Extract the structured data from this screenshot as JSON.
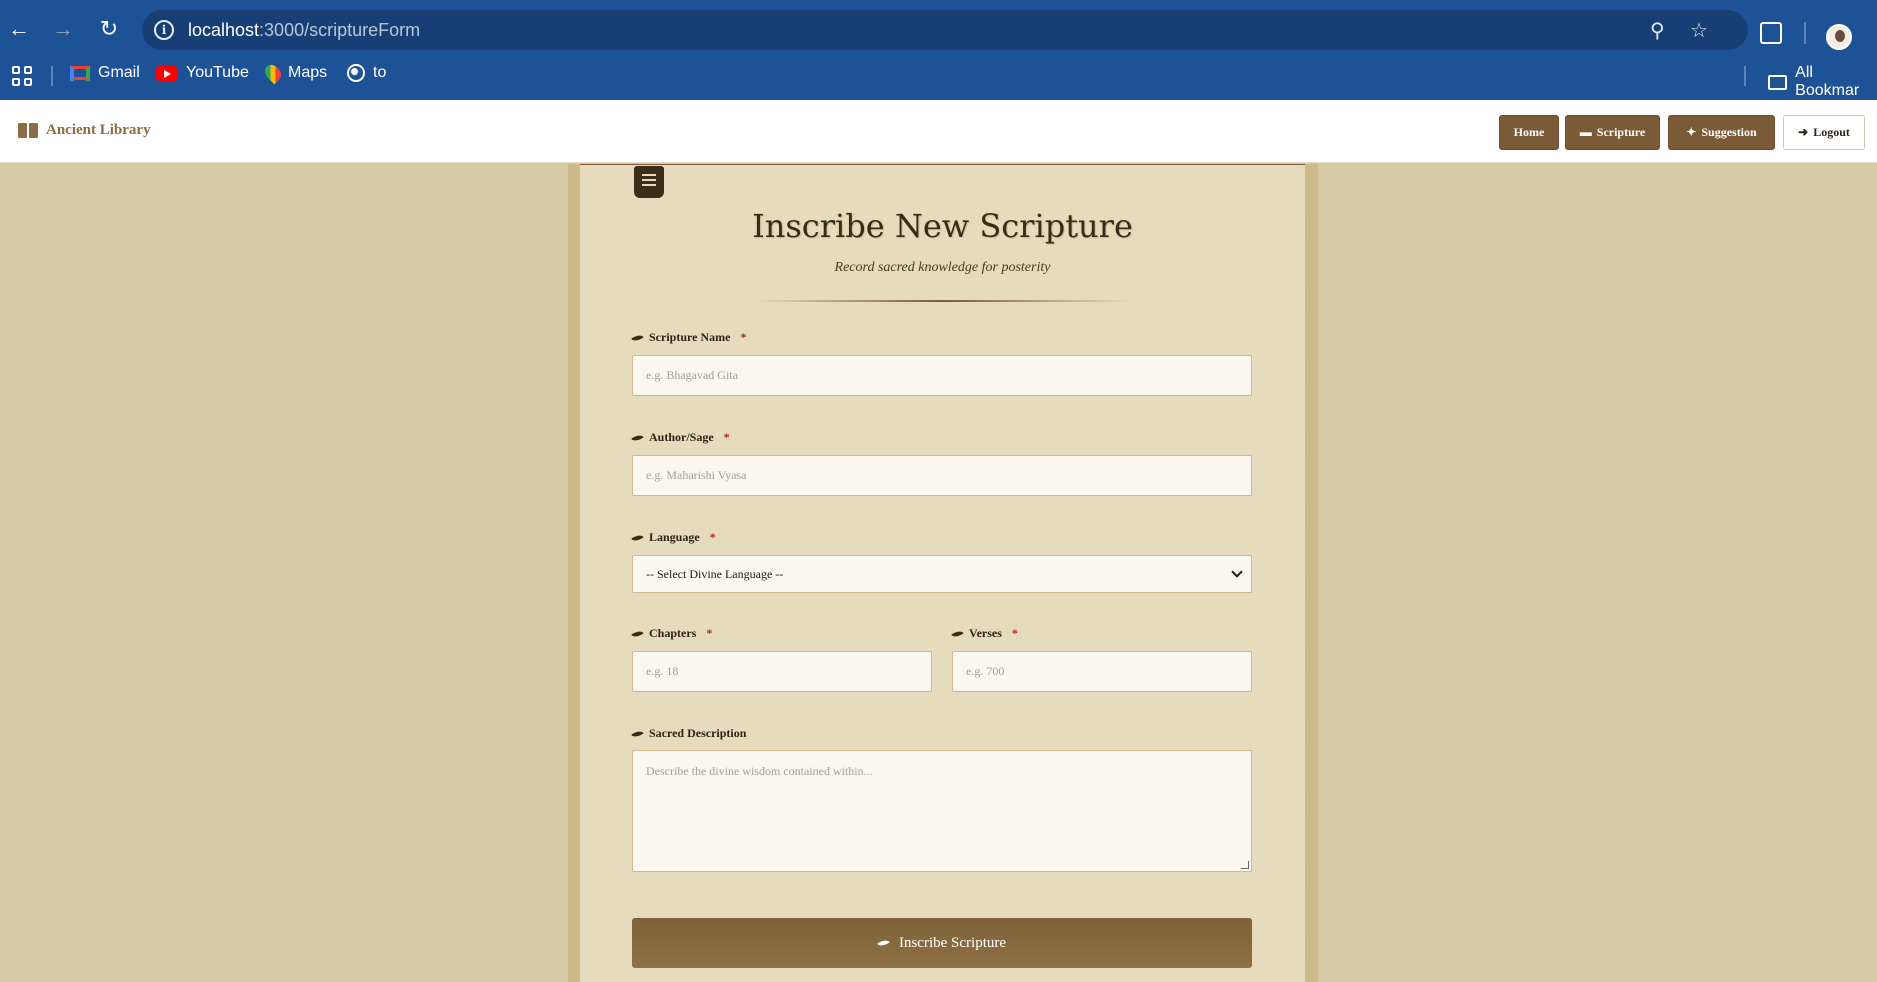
{
  "browser": {
    "url_host": "localhost",
    "url_path": ":3000/scriptureForm",
    "bookmarks": [
      {
        "label": "Gmail",
        "icon": "gmail-icon"
      },
      {
        "label": "YouTube",
        "icon": "youtube-icon"
      },
      {
        "label": "Maps",
        "icon": "maps-icon"
      },
      {
        "label": "to",
        "icon": "globe-icon"
      }
    ],
    "all_bookmarks_label": "All Bookmar"
  },
  "nav": {
    "brand": "Ancient Library",
    "home": "Home",
    "scripture": "Scripture",
    "suggestion": "Suggestion",
    "logout": "Logout"
  },
  "form": {
    "title": "Inscribe New Scripture",
    "subtitle": "Record sacred knowledge for posterity",
    "fields": {
      "name": {
        "label": "Scripture Name",
        "placeholder": "e.g. Bhagavad Gita",
        "required": "*"
      },
      "author": {
        "label": "Author/Sage",
        "placeholder": "e.g. Maharishi Vyasa",
        "required": "*"
      },
      "language": {
        "label": "Language",
        "selected": "-- Select Divine Language --",
        "required": "*"
      },
      "chapters": {
        "label": "Chapters",
        "placeholder": "e.g. 18",
        "required": "*"
      },
      "verses": {
        "label": "Verses",
        "placeholder": "e.g. 700",
        "required": "*"
      },
      "description": {
        "label": "Sacred Description",
        "placeholder": "Describe the divine wisdom contained within..."
      }
    },
    "submit_label": "Inscribe Scripture"
  },
  "colors": {
    "browser_bar": "#1e5296",
    "brown_accent": "#7b5a38",
    "page_bg": "#d7c8a6",
    "card_bg": "#e6dbbd"
  }
}
